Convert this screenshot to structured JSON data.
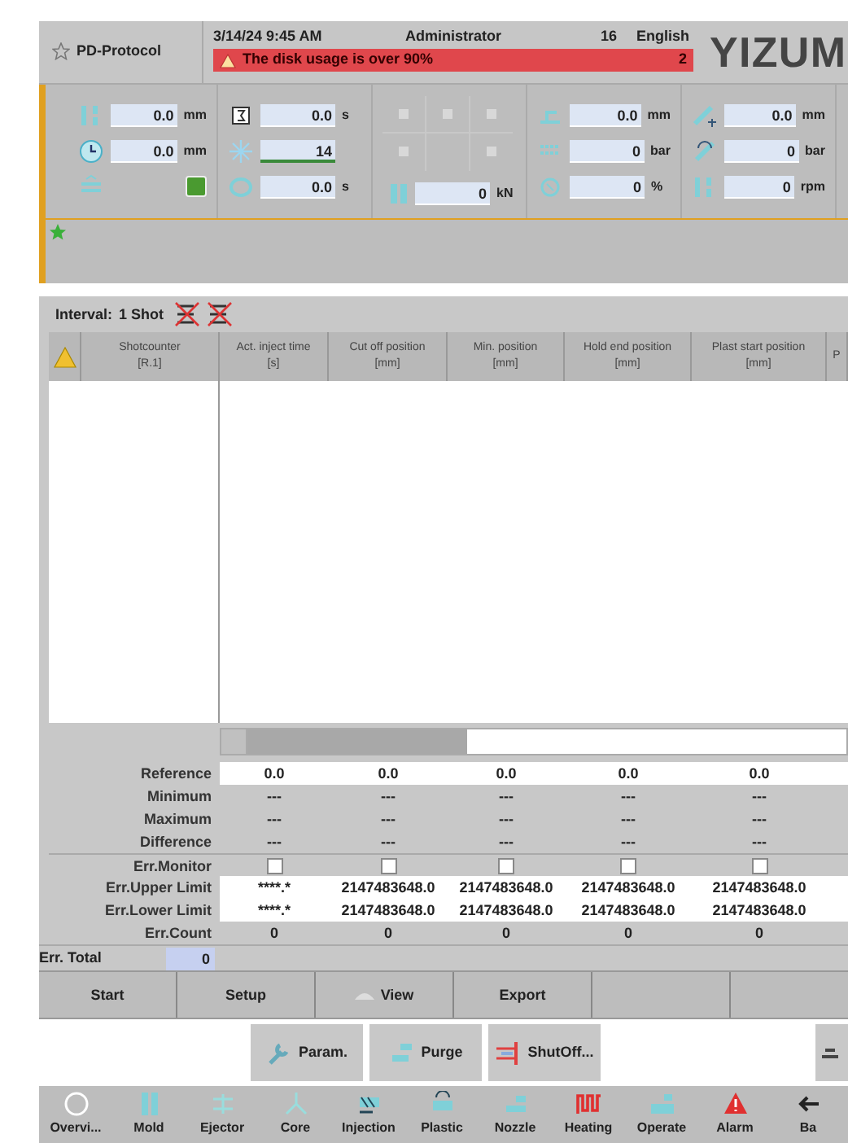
{
  "header": {
    "title": "PD-Protocol",
    "datetime": "3/14/24 9:45 AM",
    "user": "Administrator",
    "number": "16",
    "language": "English",
    "alarm": {
      "message": "The disk usage is over 90%",
      "count": "2"
    },
    "logo": "YIZUM"
  },
  "status_groups": [
    {
      "kind": "fields",
      "items": [
        {
          "kind": "field",
          "value": "0.0",
          "unit": "mm"
        },
        {
          "kind": "field",
          "value": "0.0",
          "unit": "mm"
        },
        {
          "kind": "lamp",
          "on": true
        }
      ]
    },
    {
      "kind": "fields",
      "items": [
        {
          "kind": "field",
          "value": "0.0",
          "unit": "s"
        },
        {
          "kind": "counter",
          "value": "14"
        },
        {
          "kind": "field",
          "value": "0.0",
          "unit": "s"
        }
      ]
    },
    {
      "kind": "icon_grid",
      "items": [
        {
          "kind": "field",
          "value": "0",
          "unit": "kN"
        }
      ]
    },
    {
      "kind": "fields",
      "items": [
        {
          "kind": "field",
          "value": "0.0",
          "unit": "mm"
        },
        {
          "kind": "field",
          "value": "0",
          "unit": "bar"
        },
        {
          "kind": "field",
          "value": "0",
          "unit": "%"
        }
      ]
    },
    {
      "kind": "fields",
      "items": [
        {
          "kind": "field",
          "value": "0.0",
          "unit": "mm"
        },
        {
          "kind": "field",
          "value": "0",
          "unit": "bar"
        },
        {
          "kind": "field",
          "value": "0",
          "unit": "rpm"
        }
      ]
    }
  ],
  "interval": {
    "label": "Interval:",
    "value": "1 Shot"
  },
  "table": {
    "columns": [
      {
        "title": "Shotcounter",
        "unit": "[R.1]"
      },
      {
        "title": "Act. inject time",
        "unit": "[s]"
      },
      {
        "title": "Cut off position",
        "unit": "[mm]"
      },
      {
        "title": "Min. position",
        "unit": "[mm]"
      },
      {
        "title": "Hold end position",
        "unit": "[mm]"
      },
      {
        "title": "Plast start position",
        "unit": "[mm]"
      },
      {
        "title": "P"
      }
    ]
  },
  "statistics": [
    {
      "kind": "values",
      "label": "Reference",
      "editable": true,
      "values": [
        "0.0",
        "0.0",
        "0.0",
        "0.0",
        "0.0"
      ]
    },
    {
      "kind": "values",
      "label": "Minimum",
      "editable": false,
      "values": [
        "---",
        "---",
        "---",
        "---",
        "---"
      ]
    },
    {
      "kind": "values",
      "label": "Maximum",
      "editable": false,
      "values": [
        "---",
        "---",
        "---",
        "---",
        "---"
      ]
    },
    {
      "kind": "values",
      "label": "Difference",
      "editable": false,
      "values": [
        "---",
        "---",
        "---",
        "---",
        "---"
      ]
    },
    {
      "kind": "checkboxes",
      "label": "Err.Monitor",
      "editable": false,
      "cells": [
        {
          "checked": false
        },
        {
          "checked": false
        },
        {
          "checked": false
        },
        {
          "checked": false
        },
        {
          "checked": false
        }
      ]
    },
    {
      "kind": "values",
      "label": "Err.Upper Limit",
      "editable": true,
      "values": [
        "****.*",
        "2147483648.0",
        "2147483648.0",
        "2147483648.0",
        "2147483648.0"
      ]
    },
    {
      "kind": "values",
      "label": "Err.Lower Limit",
      "editable": true,
      "values": [
        "****.*",
        "2147483648.0",
        "2147483648.0",
        "2147483648.0",
        "2147483648.0"
      ]
    },
    {
      "kind": "values",
      "label": "Err.Count",
      "editable": false,
      "values": [
        "0",
        "0",
        "0",
        "0",
        "0"
      ]
    }
  ],
  "err_total": {
    "label": "Err. Total",
    "value": "0"
  },
  "function_keys": [
    {
      "kind": "text",
      "label": "Start"
    },
    {
      "kind": "text",
      "label": "Setup"
    },
    {
      "kind": "icon",
      "label": "View"
    },
    {
      "kind": "text",
      "label": "Export"
    },
    {
      "kind": "blank"
    },
    {
      "kind": "blank"
    }
  ],
  "action_buttons": [
    {
      "kind": "labeled",
      "label": "Param."
    },
    {
      "kind": "labeled",
      "label": "Purge"
    },
    {
      "kind": "labeled",
      "label": "ShutOff..."
    },
    {
      "kind": "partial"
    }
  ],
  "nav": [
    {
      "label": "Overvi..."
    },
    {
      "label": "Mold"
    },
    {
      "label": "Ejector"
    },
    {
      "label": "Core"
    },
    {
      "label": "Injection"
    },
    {
      "label": "Plastic"
    },
    {
      "label": "Nozzle"
    },
    {
      "label": "Heating"
    },
    {
      "label": "Operate"
    },
    {
      "label": "Alarm"
    },
    {
      "label": "Ba"
    }
  ]
}
